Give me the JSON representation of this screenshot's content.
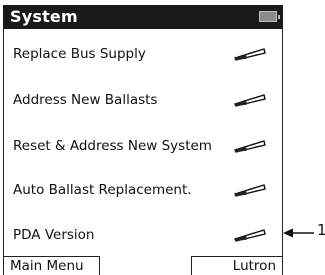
{
  "header": {
    "title": "System"
  },
  "menu": {
    "items": [
      {
        "label": "Replace Bus Supply"
      },
      {
        "label": "Address New Ballasts"
      },
      {
        "label": "Reset & Address New System"
      },
      {
        "label": "Auto Ballast Replacement."
      },
      {
        "label": "PDA Version"
      }
    ]
  },
  "annotation": {
    "callout": "1"
  },
  "softkeys": {
    "left": "Main Menu",
    "right": "Lutron"
  }
}
